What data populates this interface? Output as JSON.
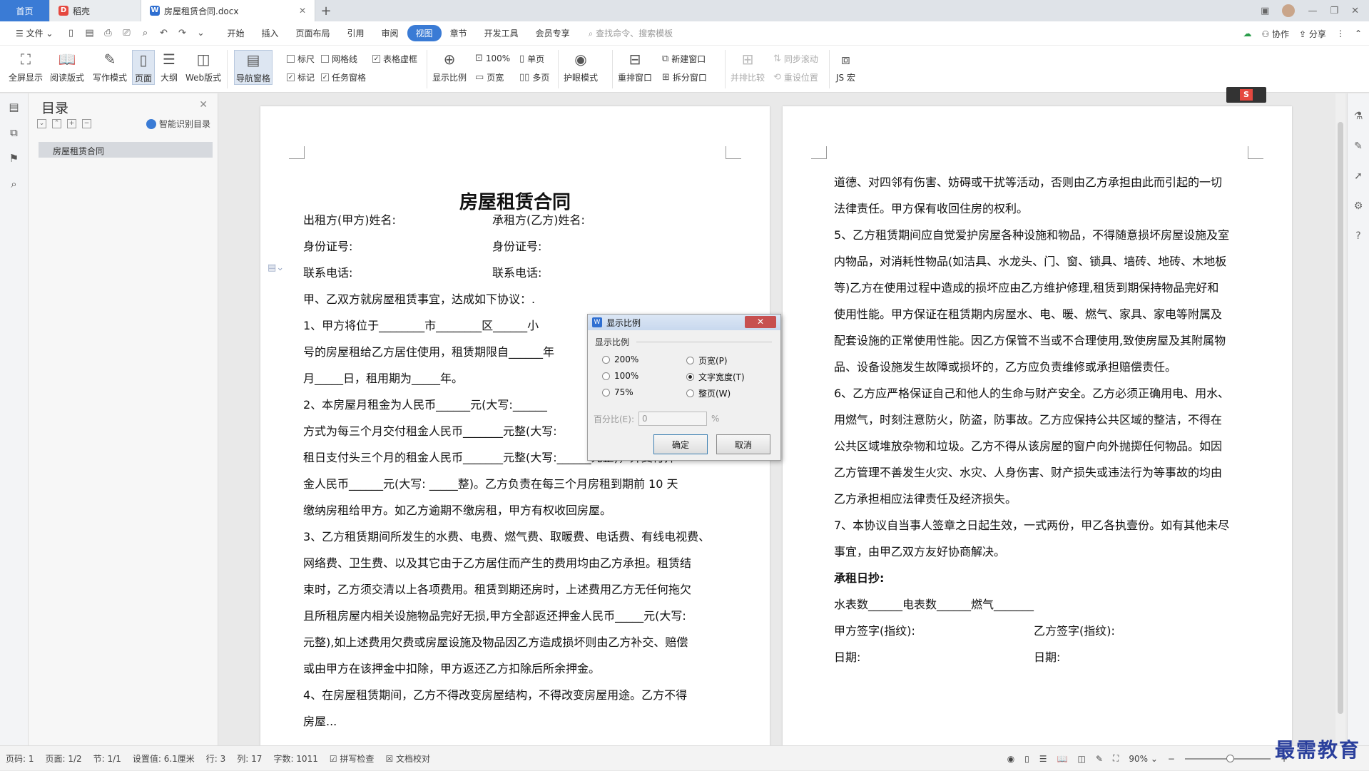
{
  "tabs": {
    "home": "首页",
    "daoke": "稻壳",
    "doc": "房屋租赁合同.docx"
  },
  "menu": {
    "file": "文件",
    "items": [
      "开始",
      "插入",
      "页面布局",
      "引用",
      "审阅",
      "视图",
      "章节",
      "开发工具",
      "会员专享"
    ],
    "active_index": 5,
    "search": "查找命令、搜索模板",
    "collab": "协作",
    "share": "分享"
  },
  "ribbon": {
    "fullscreen": "全屏显示",
    "reading": "阅读版式",
    "writing": "写作模式",
    "page": "页面",
    "outline": "大纲",
    "web": "Web版式",
    "navpane": "导航窗格",
    "ruler": "标尺",
    "gridlines": "网格线",
    "tablegrid": "表格虚框",
    "marks": "标记",
    "taskpane": "任务窗格",
    "zoom": "显示比例",
    "zoom100": "100%",
    "pagewidth": "页宽",
    "single": "单页",
    "multi": "多页",
    "eyecare": "护眼模式",
    "rearrange": "重排窗口",
    "newwin": "新建窗口",
    "split": "拆分窗口",
    "sidebyside": "并排比较",
    "syncscroll": "同步滚动",
    "resetpos": "重设位置",
    "jsmacro": "JS 宏"
  },
  "toc": {
    "title": "目录",
    "smart": "智能识别目录",
    "item": "房屋租赁合同"
  },
  "page1": {
    "title": "房屋租赁合同",
    "lines": [
      "出租方(甲方)姓名:",
      "承租方(乙方)姓名:",
      "身份证号:",
      "身份证号:",
      "联系电话:",
      "联系电话:",
      "甲、乙双方就房屋租赁事宜，达成如下协议：.",
      "1、甲方将位于________市________区______小",
      "号的房屋租给乙方居住使用，租赁期限自______年",
      "月_____日，租用期为_____年。",
      "2、本房屋月租金为人民币______元(大写:______",
      "方式为每三个月交付租金人民币_______元整(大写:",
      "租日支付头三个月的租金人民币_______元整(大写:______元整)，并支付押",
      "金人民币______元(大写: _____整)。乙方负责在每三个月房租到期前 10 天",
      "缴纳房租给甲方。如乙方逾期不缴房租，甲方有权收回房屋。",
      "3、乙方租赁期间所发生的水费、电费、燃气费、取暖费、电话费、有线电视费、",
      "网络费、卫生费、以及其它由于乙方居住而产生的费用均由乙方承担。租赁结",
      "束时，乙方须交清以上各项费用。租赁到期还房时，上述费用乙方无任何拖欠",
      "且所租房屋内相关设施物品完好无损,甲方全部返还押金人民币_____元(大写:",
      "元整),如上述费用欠费或房屋设施及物品因乙方造成损坏则由乙方补交、赔偿",
      "或由甲方在该押金中扣除，甲方返还乙方扣除后所余押金。",
      "4、在房屋租赁期间，乙方不得改变房屋结构，不得改变房屋用途。乙方不得",
      "房屋..."
    ]
  },
  "page2": {
    "lines": [
      "道德、对四邻有伤害、妨碍或干扰等活动，否则由乙方承担由此而引起的一切",
      "法律责任。甲方保有收回住房的权利。",
      "5、乙方租赁期间应自觉爱护房屋各种设施和物品，不得随意损坏房屋设施及室",
      "内物品，对消耗性物品(如洁具、水龙头、门、窗、锁具、墙砖、地砖、木地板",
      "等)乙方在使用过程中造成的损坏应由乙方维护修理,租赁到期保持物品完好和",
      "使用性能。甲方保证在租赁期内房屋水、电、暖、燃气、家具、家电等附属及",
      "配套设施的正常使用性能。因乙方保管不当或不合理使用,致使房屋及其附属物",
      "品、设备设施发生故障或损坏的，乙方应负责维修或承担赔偿责任。",
      "6、乙方应严格保证自己和他人的生命与财产安全。乙方必须正确用电、用水、",
      "用燃气，时刻注意防火，防盗，防事故。乙方应保持公共区域的整洁，不得在",
      "公共区域堆放杂物和垃圾。乙方不得从该房屋的窗户向外抛掷任何物品。如因",
      "乙方管理不善发生火灾、水灾、人身伤害、财产损失或违法行为等事故的均由",
      "乙方承担相应法律责任及经济损失。",
      "7、本协议自当事人签章之日起生效，一式两份，甲乙各执壹份。如有其他未尽",
      "事宜，由甲乙双方友好协商解决。",
      "承租日抄:",
      "水表数______电表数______燃气_______",
      "甲方签字(指纹):",
      "乙方签字(指纹):",
      "日期:",
      "日期:"
    ]
  },
  "dialog": {
    "title": "显示比例",
    "group": "显示比例",
    "r200": "200%",
    "r100": "100%",
    "r75": "75%",
    "rpagewidth": "页宽(P)",
    "rtextwidth": "文字宽度(T)",
    "rwholepage": "整页(W)",
    "percent_label": "百分比(E):",
    "percent_value": "0",
    "percent_unit": "%",
    "ok": "确定",
    "cancel": "取消"
  },
  "status": {
    "pagenum": "页码: 1",
    "pages": "页面: 1/2",
    "section": "节: 1/1",
    "setting": "设置值: 6.1厘米",
    "row": "行: 3",
    "col": "列: 17",
    "words": "字数: 1011",
    "spell": "拼写检查",
    "proof": "文档校对",
    "zoom": "90%"
  },
  "watermark": "最需教育"
}
